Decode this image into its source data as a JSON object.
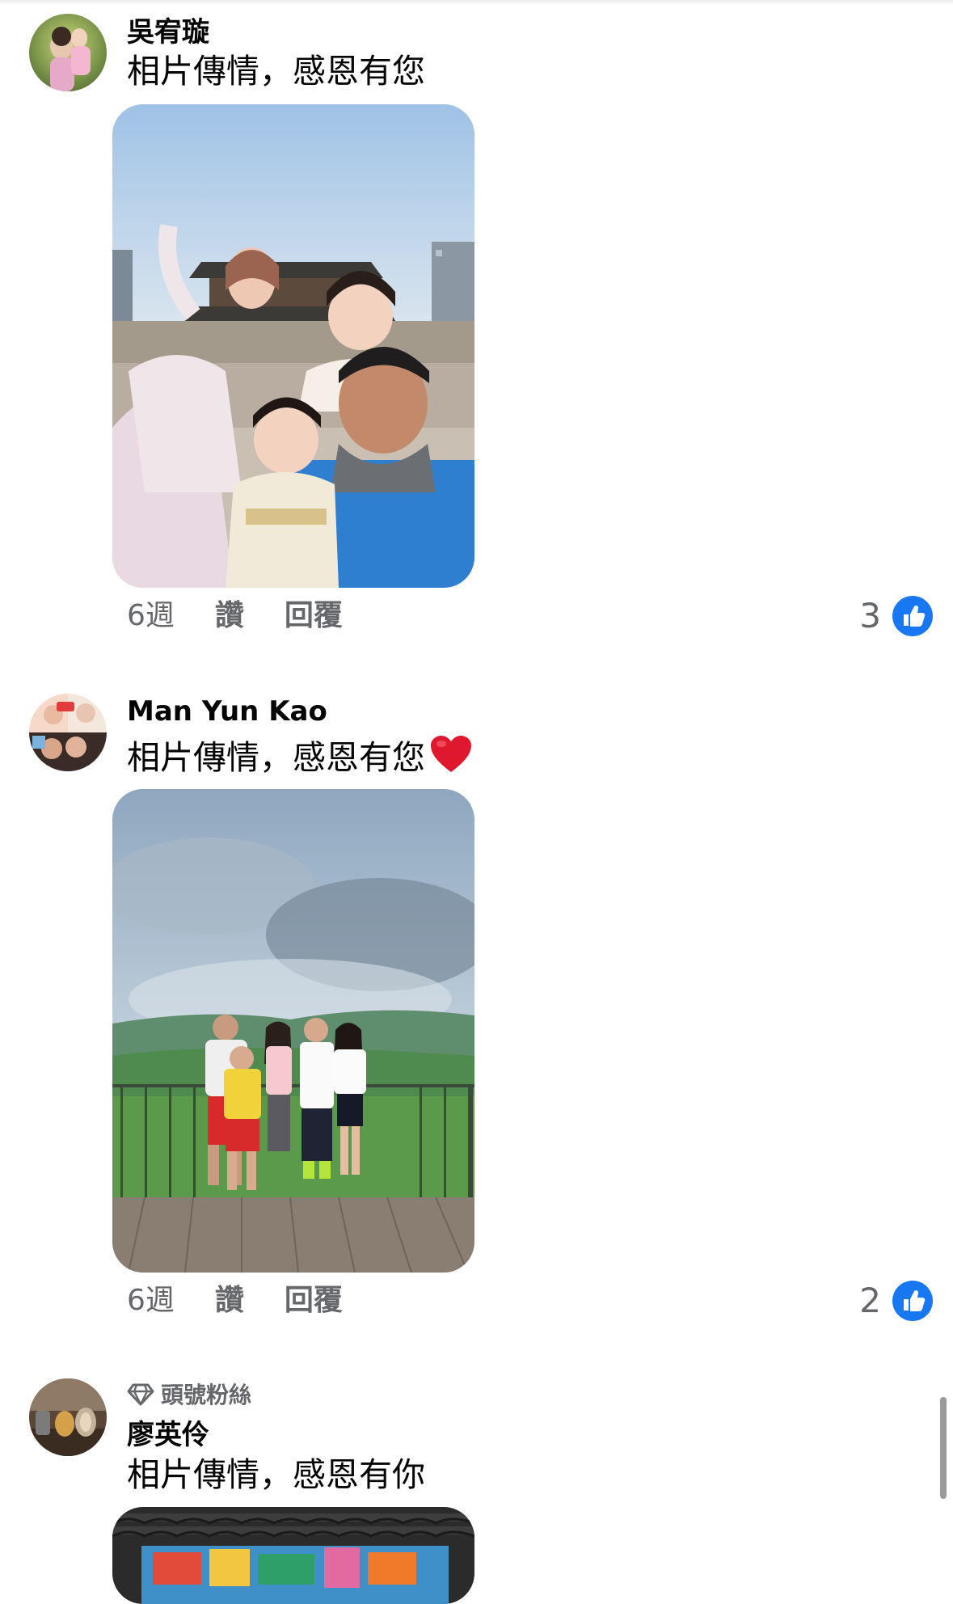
{
  "comments": [
    {
      "name": "吳宥璇",
      "text": "相片傳情，感恩有您",
      "time": "6週",
      "like_label": "讚",
      "reply_label": "回覆",
      "reaction_count": "3",
      "reaction_icon": "like-thumb-icon",
      "photo_desc": "family-photo-palace"
    },
    {
      "name": "Man Yun Kao",
      "text": "相片傳情，感恩有您",
      "emoji": "red-heart-icon",
      "time": "6週",
      "like_label": "讚",
      "reply_label": "回覆",
      "reaction_count": "2",
      "reaction_icon": "like-thumb-icon",
      "photo_desc": "family-photo-mountain"
    },
    {
      "badge": "頭號粉絲",
      "badge_icon": "diamond-icon",
      "name": "廖英伶",
      "text": "相片傳情，感恩有你",
      "photo_desc": "mural-photo"
    }
  ],
  "colors": {
    "like_blue": "#1877f2",
    "meta_gray": "#65676b",
    "heart_red": "#e0182d"
  }
}
